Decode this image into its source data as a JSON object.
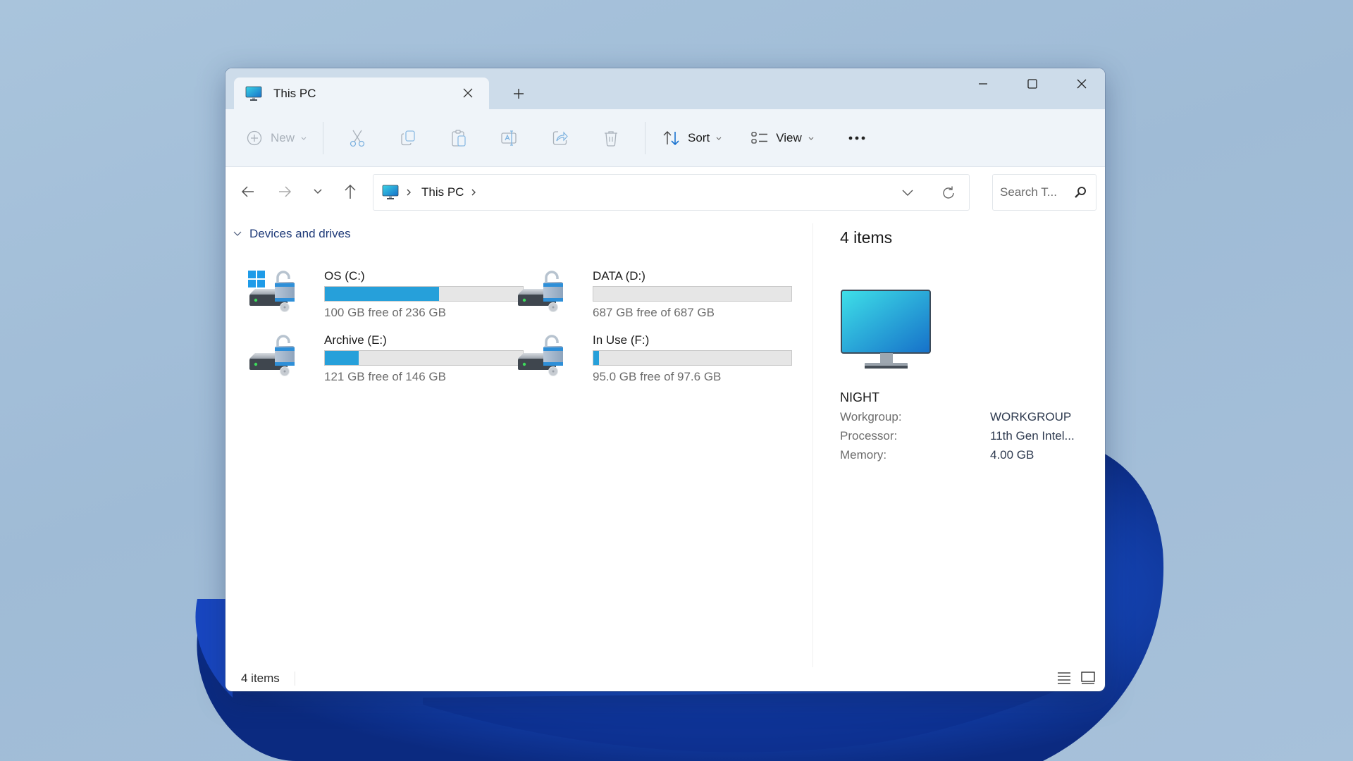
{
  "window": {
    "tab_title": "This PC",
    "tab_icon": "pc-monitor-icon",
    "close_tab_icon": "close-icon",
    "new_tab_icon": "plus-icon",
    "controls": [
      "minimize-icon",
      "maximize-icon",
      "close-icon"
    ]
  },
  "toolbar": {
    "new_label": "New",
    "actions": [
      {
        "name": "cut",
        "icon": "scissors-icon",
        "enabled": false
      },
      {
        "name": "copy",
        "icon": "copy-icon",
        "enabled": false
      },
      {
        "name": "paste",
        "icon": "clipboard-icon",
        "enabled": false
      },
      {
        "name": "rename",
        "icon": "rename-icon",
        "enabled": false
      },
      {
        "name": "share",
        "icon": "share-icon",
        "enabled": false
      },
      {
        "name": "delete",
        "icon": "trash-icon",
        "enabled": false
      }
    ],
    "sort_label": "Sort",
    "view_label": "View",
    "more_icon": "ellipsis-icon"
  },
  "navigation": {
    "back_icon": "arrow-left-icon",
    "forward_icon": "arrow-right-icon",
    "recent_icon": "chevron-down-icon",
    "up_icon": "arrow-up-icon",
    "breadcrumb": [
      "This PC"
    ],
    "search_placeholder": "Search T..."
  },
  "content": {
    "group_label": "Devices and drives",
    "drives": [
      {
        "name": "OS (C:)",
        "free_text": "100 GB free of 236 GB",
        "used_fraction": 0.576,
        "windows_logo": true
      },
      {
        "name": "DATA (D:)",
        "free_text": "687 GB free of 687 GB",
        "used_fraction": 0.0,
        "windows_logo": false
      },
      {
        "name": "Archive (E:)",
        "free_text": "121 GB free of 146 GB",
        "used_fraction": 0.171,
        "windows_logo": false
      },
      {
        "name": "In Use (F:)",
        "free_text": "95.0 GB free of 97.6 GB",
        "used_fraction": 0.027,
        "windows_logo": false
      }
    ]
  },
  "details": {
    "count": "4 items",
    "pc_name": "NIGHT",
    "properties": [
      {
        "key": "Workgroup:",
        "value": "WORKGROUP"
      },
      {
        "key": "Processor:",
        "value": "11th Gen Intel..."
      },
      {
        "key": "Memory:",
        "value": "4.00 GB"
      }
    ]
  },
  "status": {
    "count": "4 items",
    "view_buttons": [
      "details-view-icon",
      "tiles-view-icon"
    ]
  },
  "colors": {
    "accent": "#26a0da",
    "group_header": "#1e3a78",
    "tab_strip": "#cddcea",
    "toolbar": "#eff4f9"
  }
}
